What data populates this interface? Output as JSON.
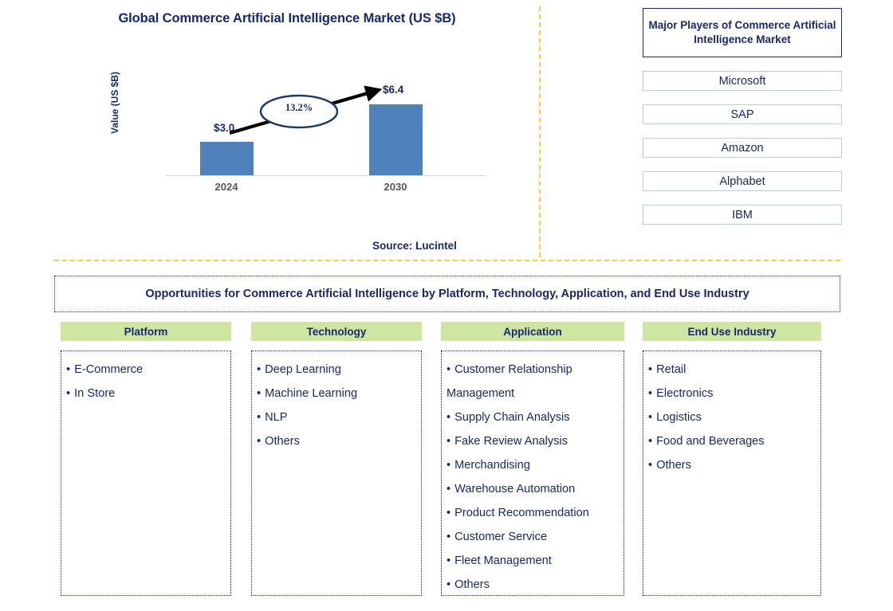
{
  "chart_data": {
    "type": "bar",
    "title": "Global Commerce Artificial Intelligence Market (US $B)",
    "ylabel": "Value (US $B)",
    "xlabel": "",
    "categories": [
      "2024",
      "2030"
    ],
    "values": [
      3.0,
      6.4
    ],
    "value_labels": [
      "$3.0",
      "$6.4"
    ],
    "cagr_label": "13.2%",
    "ylim": [
      0,
      7.2
    ],
    "grid": false,
    "legend": "none",
    "bar_color": "#4F81BD",
    "source": "Source: Lucintel"
  },
  "players": {
    "title": "Major Players of Commerce Artificial Intelligence Market",
    "items": [
      {
        "name": "Microsoft"
      },
      {
        "name": "SAP"
      },
      {
        "name": "Amazon"
      },
      {
        "name": "Alphabet"
      },
      {
        "name": "IBM"
      }
    ]
  },
  "opportunities": {
    "banner": "Opportunities for Commerce Artificial Intelligence by Platform, Technology, Application, and End Use Industry",
    "columns": [
      {
        "header": "Platform",
        "items": [
          "E-Commerce",
          "In Store"
        ]
      },
      {
        "header": "Technology",
        "items": [
          "Deep Learning",
          "Machine Learning",
          "NLP",
          "Others"
        ]
      },
      {
        "header": "Application",
        "items": [
          "Customer Relationship Management",
          "Supply Chain Analysis",
          "Fake Review Analysis",
          "Merchandising",
          "Warehouse Automation",
          "Product Recommendation",
          "Customer Service",
          "Fleet Management",
          "Others"
        ]
      },
      {
        "header": "End Use Industry",
        "items": [
          "Retail",
          "Electronics",
          "Logistics",
          "Food and Beverages",
          "Others"
        ]
      }
    ]
  },
  "colors": {
    "accent_gold": "#FFC845",
    "header_green": "#CFE6A3",
    "text_navy": "#17296B",
    "bar_blue": "#4F81BD",
    "player_border": "#B8CCE4"
  }
}
